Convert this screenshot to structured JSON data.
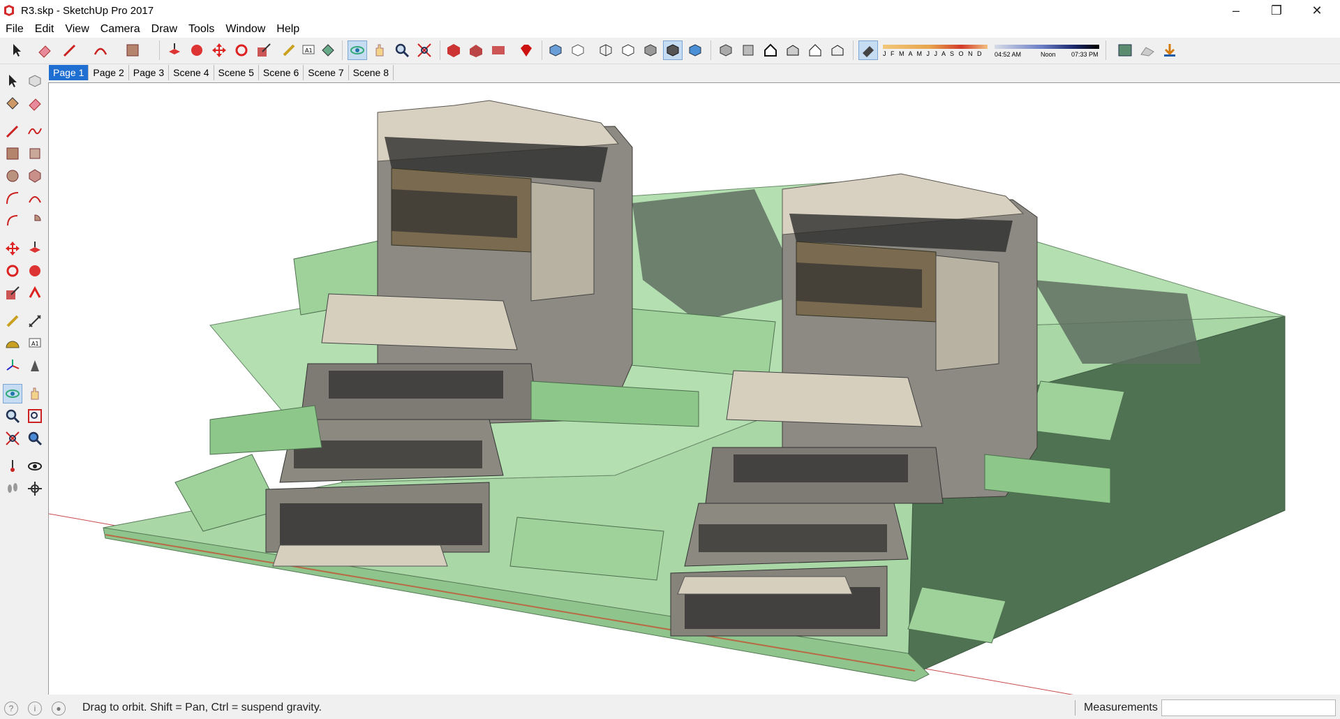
{
  "window": {
    "title": "R3.skp - SketchUp Pro 2017",
    "controls": {
      "minimize": "–",
      "maximize": "❐",
      "close": "✕"
    }
  },
  "menu": [
    "File",
    "Edit",
    "View",
    "Camera",
    "Draw",
    "Tools",
    "Window",
    "Help"
  ],
  "shadow_settings": {
    "months": "J F M A M J J A S O N D",
    "time_start": "04:52 AM",
    "time_mid": "Noon",
    "time_end": "07:33 PM"
  },
  "scenes": [
    "Page 1",
    "Page 2",
    "Page 3",
    "Scene 4",
    "Scene 5",
    "Scene 6",
    "Scene 7",
    "Scene 8"
  ],
  "active_scene": "Page 1",
  "status": {
    "hint": "Drag to orbit. Shift = Pan, Ctrl = suspend gravity.",
    "measurements_label": "Measurements",
    "measurements_value": ""
  },
  "colors": {
    "terrain_green": "#a6d6a3",
    "terrain_dark": "#4d6f4e",
    "building_stone": "#8e8a82",
    "building_light": "#d8d2c2",
    "accent_active": "#1e6fd1"
  }
}
